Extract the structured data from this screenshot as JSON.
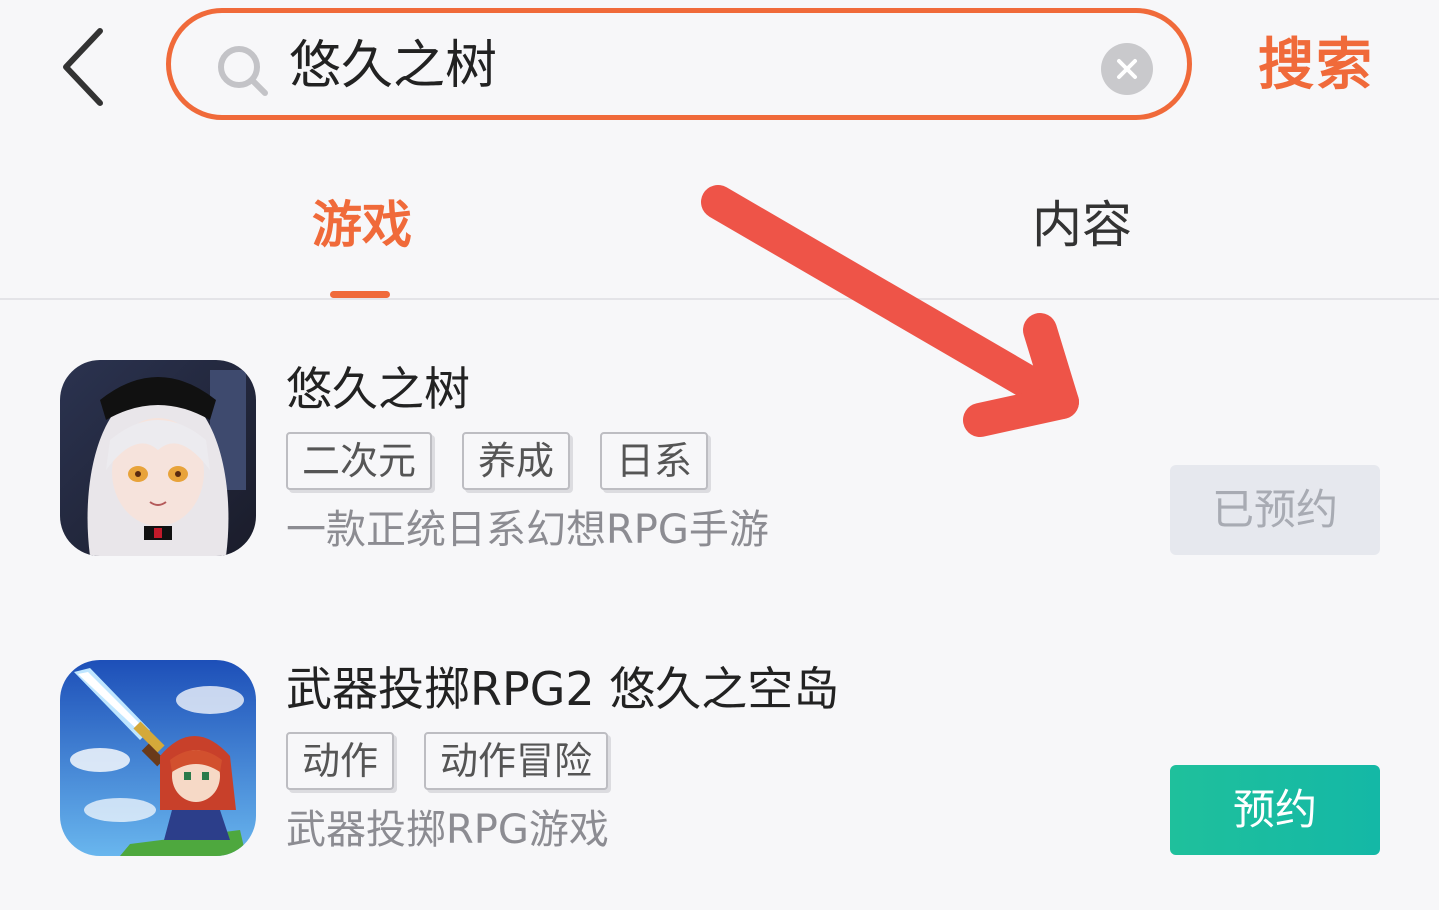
{
  "header": {
    "search_value": "悠久之树",
    "search_button_label": "搜索"
  },
  "tabs": [
    {
      "label": "游戏",
      "active": true
    },
    {
      "label": "内容",
      "active": false
    }
  ],
  "results": [
    {
      "title": "悠久之树",
      "tags": [
        "二次元",
        "养成",
        "日系"
      ],
      "description": "一款正统日系幻想RPG手游",
      "action_label": "已预约",
      "action_state": "reserved"
    },
    {
      "title": "武器投掷RPG2 悠久之空岛",
      "tags": [
        "动作",
        "动作冒险"
      ],
      "description": "武器投掷RPG游戏",
      "action_label": "预约",
      "action_state": "available"
    }
  ],
  "colors": {
    "accent": "#f06a3a",
    "reserve_button": "#1fc09c",
    "reserved_button": "#e6e8ee",
    "annotation_arrow": "#ee5448"
  }
}
